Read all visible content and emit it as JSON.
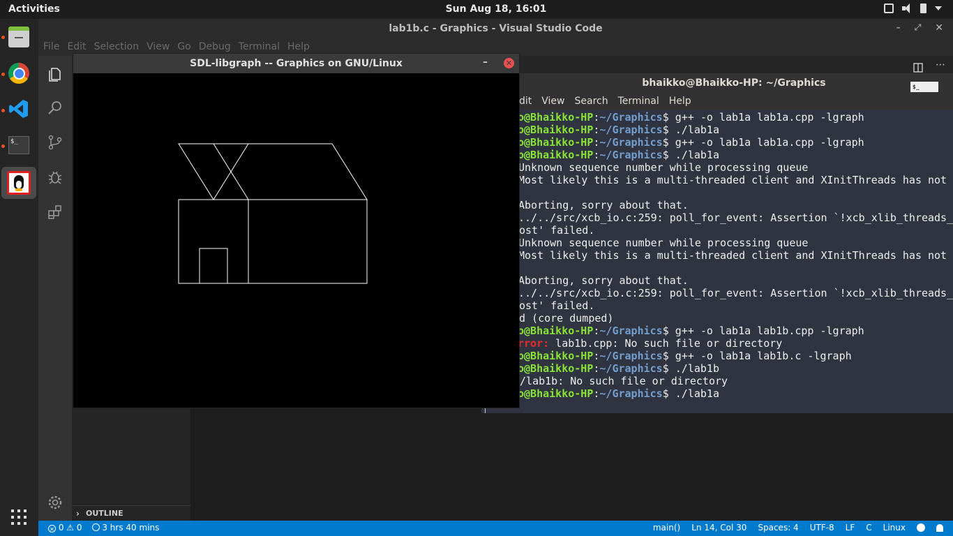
{
  "topbar": {
    "activities": "Activities",
    "clock": "Sun Aug 18, 16:01"
  },
  "dock": {
    "items": [
      {
        "name": "files",
        "icon": "file-cabinet-icon"
      },
      {
        "name": "chrome",
        "icon": "chrome-icon"
      },
      {
        "name": "vscode",
        "icon": "vscode-icon"
      },
      {
        "name": "terminal",
        "icon": "terminal-icon",
        "text": "$_"
      },
      {
        "name": "sdl-libgraph",
        "icon": "penguin-icon"
      }
    ],
    "apps_grid_icon": "apps-grid-icon"
  },
  "vscode": {
    "title": "lab1b.c - Graphics - Visual Studio Code",
    "menu": [
      "File",
      "Edit",
      "Selection",
      "View",
      "Go",
      "Debug",
      "Terminal",
      "Help"
    ],
    "outline_label": "OUTLINE",
    "status": {
      "errors": "0",
      "warnings": "0",
      "time": "3 hrs 40 mins",
      "function": "main()",
      "position": "Ln 14, Col 30",
      "spaces": "Spaces: 4",
      "encoding": "UTF-8",
      "eol": "LF",
      "language": "C",
      "platform": "Linux"
    },
    "accent_color": "#007acc"
  },
  "terminal": {
    "title": "bhaikko@Bhaikko-HP: ~/Graphics",
    "badge": "$_",
    "menu": [
      "dit",
      "View",
      "Search",
      "Terminal",
      "Help"
    ],
    "lines": [
      {
        "user": "o@Bhaikko-HP",
        "path": "~/Graphics",
        "cmd": "$ g++ -o lab1a lab1a.cpp -lgraph"
      },
      {
        "user": "o@Bhaikko-HP",
        "path": "~/Graphics",
        "cmd": "$ ./lab1a"
      },
      {
        "user": "o@Bhaikko-HP",
        "path": "~/Graphics",
        "cmd": "$ g++ -o lab1a lab1a.cpp -lgraph"
      },
      {
        "user": "o@Bhaikko-HP",
        "path": "~/Graphics",
        "cmd": "$ ./lab1a"
      },
      {
        "text": "Unknown sequence number while processing queue"
      },
      {
        "text": "Most likely this is a multi-threaded client and XInitThreads has not b"
      },
      {
        "text": ""
      },
      {
        "text": "Aborting, sorry about that."
      },
      {
        "text": "../../src/xcb_io.c:259: poll_for_event: Assertion `!xcb_xlib_threads_"
      },
      {
        "text": "ost' failed."
      },
      {
        "text": "Unknown sequence number while processing queue"
      },
      {
        "text": "Most likely this is a multi-threaded client and XInitThreads has not b"
      },
      {
        "text": ""
      },
      {
        "text": "Aborting, sorry about that."
      },
      {
        "text": "../../src/xcb_io.c:259: poll_for_event: Assertion `!xcb_xlib_threads_"
      },
      {
        "text": "ost' failed."
      },
      {
        "text": "d (core dumped)"
      },
      {
        "user": "o@Bhaikko-HP",
        "path": "~/Graphics",
        "cmd": "$ g++ -o lab1a lab1b.cpp -lgraph"
      },
      {
        "error": "rror:",
        "text": " lab1b.cpp: No such file or directory"
      },
      {
        "user": "o@Bhaikko-HP",
        "path": "~/Graphics",
        "cmd": "$ g++ -o lab1a lab1b.c -lgraph"
      },
      {
        "user": "o@Bhaikko-HP",
        "path": "~/Graphics",
        "cmd": "$ ./lab1b"
      },
      {
        "text": "./lab1b: No such file or directory"
      },
      {
        "user": "o@Bhaikko-HP",
        "path": "~/Graphics",
        "cmd": "$ ./lab1a"
      }
    ]
  },
  "sdl": {
    "title": "SDL-libgraph -- Graphics on GNU/Linux",
    "minimize": "–",
    "close": "✕"
  }
}
